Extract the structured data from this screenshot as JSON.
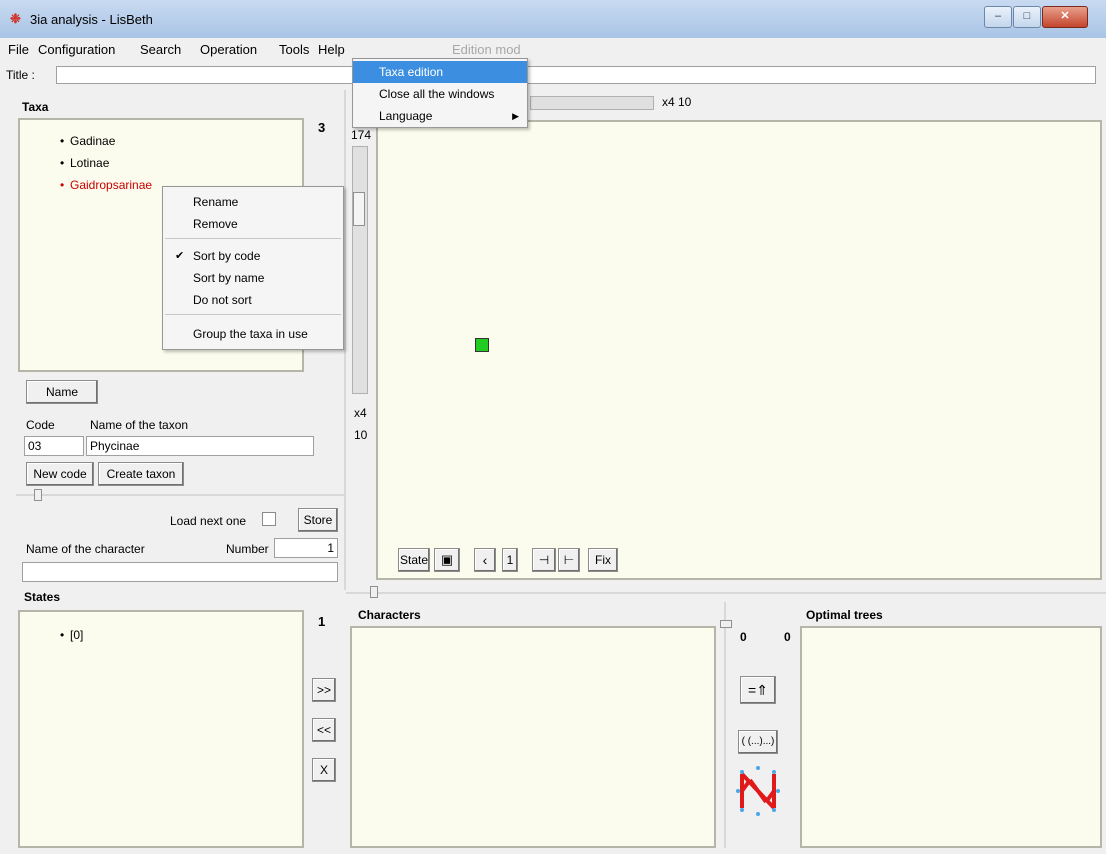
{
  "window": {
    "title": "3ia analysis - LisBeth",
    "app_icon": "lisbeth-logo-icon",
    "minimize_label": "–",
    "maximize_label": "□",
    "close_label": "✕"
  },
  "menubar": {
    "items": [
      "File",
      "Configuration",
      "Search",
      "Operation",
      "Tools",
      "Help"
    ],
    "mode_label": "Edition mod"
  },
  "title_field": {
    "label": "Title :",
    "value": ""
  },
  "tools_menu": {
    "items": [
      {
        "label": "Taxa edition",
        "highlighted": true
      },
      {
        "label": "Close all the windows"
      },
      {
        "label": "Language",
        "submenu": true
      }
    ]
  },
  "taxa": {
    "header": "Taxa",
    "count": "3",
    "items": [
      {
        "label": "Gadinae",
        "color": "#000000"
      },
      {
        "label": "Lotinae",
        "color": "#000000"
      },
      {
        "label": "Gaidropsarinae",
        "color": "#cc0000"
      }
    ]
  },
  "context_menu": {
    "items": [
      "Rename",
      "Remove"
    ],
    "sort_items": [
      {
        "label": "Sort by code",
        "checked": true
      },
      {
        "label": "Sort by name",
        "checked": false
      },
      {
        "label": "Do not sort",
        "checked": false
      }
    ],
    "group_item": "Group the taxa in use",
    "check_mark": "✔"
  },
  "taxon_form": {
    "name_button": "Name",
    "code_label": "Code",
    "name_label": "Name of the taxon",
    "code_value": "03",
    "name_value": "Phycinae",
    "new_code_button": "New code",
    "create_taxon_button": "Create taxon"
  },
  "character_form": {
    "load_next_label": "Load next one",
    "store_button": "Store",
    "name_label": "Name of the character",
    "number_label": "Number",
    "number_value": "1",
    "name_value": ""
  },
  "states": {
    "header": "States",
    "count": "1",
    "items": [
      "[0]"
    ],
    "add_button": ">>",
    "remove_button": "<<",
    "delete_button": "X"
  },
  "vertical_zoom": {
    "top_label": "174",
    "bottom_label1": "x4",
    "bottom_label2": "10"
  },
  "canvas": {
    "zoom_label": "x4  10",
    "node_color": "#22cc22",
    "toolbar": {
      "state_button": "State",
      "one_button": "1",
      "fix_button": "Fix"
    }
  },
  "characters": {
    "header": "Characters"
  },
  "optimal_trees": {
    "header": "Optimal trees",
    "count_left": "0",
    "count_right": "0",
    "export_button": "=⇑",
    "newick_button": "( (...)...)"
  }
}
